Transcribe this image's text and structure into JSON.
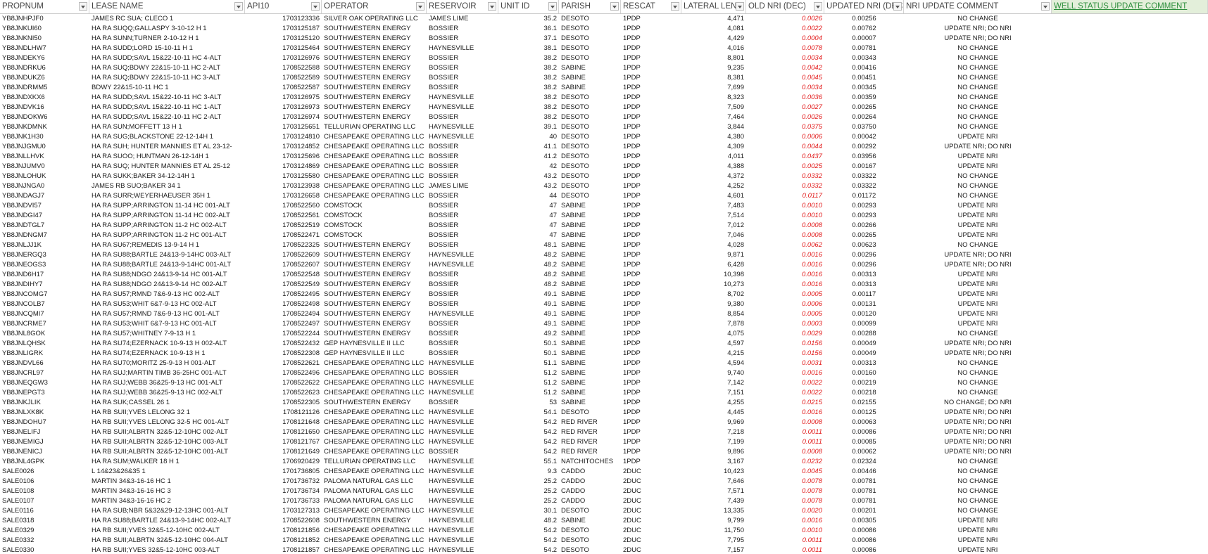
{
  "columns": [
    {
      "key": "propnum",
      "label": "PROPNUM"
    },
    {
      "key": "lease",
      "label": "LEASE NAME"
    },
    {
      "key": "api",
      "label": "API10"
    },
    {
      "key": "operator",
      "label": "OPERATOR"
    },
    {
      "key": "reservoir",
      "label": "RESERVOIR"
    },
    {
      "key": "unit_id",
      "label": "UNIT ID"
    },
    {
      "key": "parish",
      "label": "PARISH"
    },
    {
      "key": "rescat",
      "label": "RESCAT"
    },
    {
      "key": "lateral",
      "label": "LATERAL LEN"
    },
    {
      "key": "old_nri",
      "label": "OLD NRI (DEC)"
    },
    {
      "key": "new_nri",
      "label": "UPDATED NRI (DEC.)"
    },
    {
      "key": "comment",
      "label": "NRI UPDATE COMMENT"
    },
    {
      "key": "status",
      "label": "WELL STATUS UPDATE COMMENT"
    }
  ],
  "colors": {
    "old_nri_text": "#e21b1b",
    "highlight_header_bg": "#e3efda",
    "highlight_header_text": "#2f8f3e"
  },
  "rows": [
    [
      "YB8JNHPJF0",
      "JAMES RC SUA; CLECO 1",
      "1703123336",
      "SILVER OAK OPERATING LLC",
      "JAMES LIME",
      "35.2",
      "DESOTO",
      "1PDP",
      "4,471",
      "0.0026",
      "0.00256",
      "NO CHANGE",
      ""
    ],
    [
      "YB8JNKUI60",
      "HA RA SUQQ;GALLASPY 3-10-12 H 1",
      "1703125187",
      "SOUTHWESTERN ENERGY",
      "BOSSIER",
      "36.1",
      "DESOTO",
      "1PDP",
      "4,081",
      "0.0022",
      "0.00762",
      "UPDATE NRI; DO NRI",
      ""
    ],
    [
      "YB8JNKNI50",
      "HA RA SUNN;TURNER 2-10-12 H 1",
      "1703125120",
      "SOUTHWESTERN ENERGY",
      "BOSSIER",
      "37.1",
      "DESOTO",
      "1PDP",
      "4,429",
      "0.0004",
      "0.00007",
      "UPDATE NRI; DO NRI",
      ""
    ],
    [
      "YB8JNDLHW7",
      "HA RA SUDD;LORD 15-10-11 H 1",
      "1703125464",
      "SOUTHWESTERN ENERGY",
      "HAYNESVILLE",
      "38.1",
      "DESOTO",
      "1PDP",
      "4,016",
      "0.0078",
      "0.00781",
      "NO CHANGE",
      ""
    ],
    [
      "YB8JNDEKY6",
      "HA RA SUDD;SAVL 15&22-10-11 HC 4-ALT",
      "1703126976",
      "SOUTHWESTERN ENERGY",
      "BOSSIER",
      "38.2",
      "DESOTO",
      "1PDP",
      "8,801",
      "0.0034",
      "0.00343",
      "NO CHANGE",
      ""
    ],
    [
      "YB8JNDRKU6",
      "HA RA SUQ;BDWY 22&15-10-11 HC 2-ALT",
      "1708522588",
      "SOUTHWESTERN ENERGY",
      "BOSSIER",
      "38.2",
      "SABINE",
      "1PDP",
      "9,235",
      "0.0042",
      "0.00416",
      "NO CHANGE",
      ""
    ],
    [
      "YB8JNDUKZ6",
      "HA RA SUQ;BDWY 22&15-10-11 HC 3-ALT",
      "1708522589",
      "SOUTHWESTERN ENERGY",
      "BOSSIER",
      "38.2",
      "SABINE",
      "1PDP",
      "8,381",
      "0.0045",
      "0.00451",
      "NO CHANGE",
      ""
    ],
    [
      "YB8JNDRMM5",
      "BDWY 22&15-10-11 HC 1",
      "1708522587",
      "SOUTHWESTERN ENERGY",
      "BOSSIER",
      "38.2",
      "SABINE",
      "1PDP",
      "7,699",
      "0.0034",
      "0.00345",
      "NO CHANGE",
      ""
    ],
    [
      "YB8JNDXKX6",
      "HA RA SUDD;SAVL 15&22-10-11 HC 3-ALT",
      "1703126975",
      "SOUTHWESTERN ENERGY",
      "HAYNESVILLE",
      "38.2",
      "DESOTO",
      "1PDP",
      "8,323",
      "0.0036",
      "0.00359",
      "NO CHANGE",
      ""
    ],
    [
      "YB8JNDVK16",
      "HA RA SUDD;SAVL 15&22-10-11 HC 1-ALT",
      "1703126973",
      "SOUTHWESTERN ENERGY",
      "HAYNESVILLE",
      "38.2",
      "DESOTO",
      "1PDP",
      "7,509",
      "0.0027",
      "0.00265",
      "NO CHANGE",
      ""
    ],
    [
      "YB8JNDOKW6",
      "HA RA SUDD;SAVL 15&22-10-11 HC 2-ALT",
      "1703126974",
      "SOUTHWESTERN ENERGY",
      "BOSSIER",
      "38.2",
      "DESOTO",
      "1PDP",
      "7,464",
      "0.0026",
      "0.00264",
      "NO CHANGE",
      ""
    ],
    [
      "YB8JNKDMNK",
      "HA RA SUN;MOFFETT 13 H 1",
      "1703125651",
      "TELLURIAN OPERATING LLC",
      "HAYNESVILLE",
      "39.1",
      "DESOTO",
      "1PDP",
      "3,844",
      "0.0375",
      "0.03750",
      "NO CHANGE",
      ""
    ],
    [
      "YB8JNK1H30",
      "HA RA SUG;BLACKSTONE 22-12-14H 1",
      "1703124810",
      "CHESAPEAKE OPERATING LLC",
      "HAYNESVILLE",
      "40",
      "DESOTO",
      "1PDP",
      "4,380",
      "0.0006",
      "0.00042",
      "UPDATE NRI",
      ""
    ],
    [
      "YB8JNJGMU0",
      "HA RA SUH; HUNTER MANNIES ET AL 23-12-",
      "1703124852",
      "CHESAPEAKE OPERATING LLC",
      "BOSSIER",
      "41.1",
      "DESOTO",
      "1PDP",
      "4,309",
      "0.0044",
      "0.00292",
      "UPDATE NRI; DO NRI",
      ""
    ],
    [
      "YB8JNLLHVK",
      "HA RA SUOO; HUNTMAN 26-12-14H 1",
      "1703125696",
      "CHESAPEAKE OPERATING LLC",
      "BOSSIER",
      "41.2",
      "DESOTO",
      "1PDP",
      "4,011",
      "0.0437",
      "0.03956",
      "UPDATE NRI",
      ""
    ],
    [
      "YB8JNJUMV0",
      "HA RA SUQ; HUNTER MANNIES ET AL 25-12",
      "1703124869",
      "CHESAPEAKE OPERATING LLC",
      "BOSSIER",
      "42",
      "DESOTO",
      "1PDP",
      "4,388",
      "0.0025",
      "0.00167",
      "UPDATE NRI",
      ""
    ],
    [
      "YB8JNLOHUK",
      "HA RA SUKK;BAKER 34-12-14H 1",
      "1703125580",
      "CHESAPEAKE OPERATING LLC",
      "BOSSIER",
      "43.2",
      "DESOTO",
      "1PDP",
      "4,372",
      "0.0332",
      "0.03322",
      "NO CHANGE",
      ""
    ],
    [
      "YB8JNJNGA0",
      "JAMES RB SUO;BAKER 34 1",
      "1703123938",
      "CHESAPEAKE OPERATING LLC",
      "JAMES LIME",
      "43.2",
      "DESOTO",
      "1PDP",
      "4,252",
      "0.0332",
      "0.03322",
      "NO CHANGE",
      ""
    ],
    [
      "YB8JNDAGJ7",
      "HA RA SURR;WEYERHAEUSER 35H 1",
      "1703126658",
      "CHESAPEAKE OPERATING LLC",
      "BOSSIER",
      "44",
      "DESOTO",
      "1PDP",
      "4,601",
      "0.0117",
      "0.01172",
      "NO CHANGE",
      ""
    ],
    [
      "YB8JNDVI57",
      "HA RA SUPP;ARRINGTON 11-14 HC 001-ALT",
      "1708522560",
      "COMSTOCK",
      "BOSSIER",
      "47",
      "SABINE",
      "1PDP",
      "7,483",
      "0.0010",
      "0.00293",
      "UPDATE NRI",
      ""
    ],
    [
      "YB8JNDGI47",
      "HA RA SUPP;ARRINGTON 11-14 HC 002-ALT",
      "1708522561",
      "COMSTOCK",
      "BOSSIER",
      "47",
      "SABINE",
      "1PDP",
      "7,514",
      "0.0010",
      "0.00293",
      "UPDATE NRI",
      ""
    ],
    [
      "YB8JNDTGL7",
      "HA RA SUPP;ARRINGTON 11-2 HC 002-ALT",
      "1708522519",
      "COMSTOCK",
      "BOSSIER",
      "47",
      "SABINE",
      "1PDP",
      "7,012",
      "0.0008",
      "0.00266",
      "UPDATE NRI",
      ""
    ],
    [
      "YB8JNDNGM7",
      "HA RA SUPP;ARRINGTON 11-2 HC 001-ALT",
      "1708522471",
      "COMSTOCK",
      "BOSSIER",
      "47",
      "SABINE",
      "1PDP",
      "7,046",
      "0.0008",
      "0.00265",
      "UPDATE NRI",
      ""
    ],
    [
      "YB8JNLJJ1K",
      "HA RA SU67;REMEDIS 13-9-14 H 1",
      "1708522325",
      "SOUTHWESTERN ENERGY",
      "BOSSIER",
      "48.1",
      "SABINE",
      "1PDP",
      "4,028",
      "0.0062",
      "0.00623",
      "NO CHANGE",
      ""
    ],
    [
      "YB8JNERGQ3",
      "HA RA SU88;BARTLE 24&13-9-14HC 003-ALT",
      "1708522609",
      "SOUTHWESTERN ENERGY",
      "HAYNESVILLE",
      "48.2",
      "SABINE",
      "1PDP",
      "9,871",
      "0.0016",
      "0.00296",
      "UPDATE NRI; DO NRI",
      ""
    ],
    [
      "YB8JNEOGS3",
      "HA RA SU88;BARTLE 24&13-9-14HC 001-ALT",
      "1708522607",
      "SOUTHWESTERN ENERGY",
      "HAYNESVILLE",
      "48.2",
      "SABINE",
      "1PDP",
      "6,428",
      "0.0016",
      "0.00296",
      "UPDATE NRI; DO NRI",
      ""
    ],
    [
      "YB8JND6H17",
      "HA RA SU88;NDGO 24&13-9-14 HC 001-ALT",
      "1708522548",
      "SOUTHWESTERN ENERGY",
      "BOSSIER",
      "48.2",
      "SABINE",
      "1PDP",
      "10,398",
      "0.0016",
      "0.00313",
      "UPDATE NRI",
      ""
    ],
    [
      "YB8JNDIHY7",
      "HA RA SU88;NDGO 24&13-9-14 HC 002-ALT",
      "1708522549",
      "SOUTHWESTERN ENERGY",
      "BOSSIER",
      "48.2",
      "SABINE",
      "1PDP",
      "10,273",
      "0.0016",
      "0.00313",
      "UPDATE NRI",
      ""
    ],
    [
      "YB8JNCOMG7",
      "HA RA SU57;RMND 7&6-9-13 HC 002-ALT",
      "1708522495",
      "SOUTHWESTERN ENERGY",
      "BOSSIER",
      "49.1",
      "SABINE",
      "1PDP",
      "8,702",
      "0.0005",
      "0.00117",
      "UPDATE NRI",
      ""
    ],
    [
      "YB8JNCOLB7",
      "HA RA SU53;WHIT 6&7-9-13 HC 002-ALT",
      "1708522498",
      "SOUTHWESTERN ENERGY",
      "BOSSIER",
      "49.1",
      "SABINE",
      "1PDP",
      "9,380",
      "0.0006",
      "0.00131",
      "UPDATE NRI",
      ""
    ],
    [
      "YB8JNCQMI7",
      "HA RA SU57;RMND 7&6-9-13 HC 001-ALT",
      "1708522494",
      "SOUTHWESTERN ENERGY",
      "HAYNESVILLE",
      "49.1",
      "SABINE",
      "1PDP",
      "8,854",
      "0.0005",
      "0.00120",
      "UPDATE NRI",
      ""
    ],
    [
      "YB8JNCRME7",
      "HA RA SU53;WHIT 6&7-9-13 HC 001-ALT",
      "1708522497",
      "SOUTHWESTERN ENERGY",
      "BOSSIER",
      "49.1",
      "SABINE",
      "1PDP",
      "7,878",
      "0.0003",
      "0.00099",
      "UPDATE NRI",
      ""
    ],
    [
      "YB8JNL8GOK",
      "HA RA SU57;WHITNEY 7-9-13 H 1",
      "1708522244",
      "SOUTHWESTERN ENERGY",
      "BOSSIER",
      "49.2",
      "SABINE",
      "1PDP",
      "4,075",
      "0.0029",
      "0.00288",
      "NO CHANGE",
      ""
    ],
    [
      "YB8JNLQHSK",
      "HA RA SU74;EZERNACK 10-9-13 H 002-ALT",
      "1708522432",
      "GEP HAYNESVILLE II LLC",
      "BOSSIER",
      "50.1",
      "SABINE",
      "1PDP",
      "4,597",
      "0.0156",
      "0.00049",
      "UPDATE NRI; DO NRI",
      ""
    ],
    [
      "YB8JNLIGRK",
      "HA RA SU74;EZERNACK 10-9-13 H 1",
      "1708522308",
      "GEP HAYNESVILLE II LLC",
      "BOSSIER",
      "50.1",
      "SABINE",
      "1PDP",
      "4,215",
      "0.0156",
      "0.00049",
      "UPDATE NRI; DO NRI",
      ""
    ],
    [
      "YB8JNDVL66",
      "HA RA SU70;MORITZ 25-9-13 H 001-ALT",
      "1708522621",
      "CHESAPEAKE OPERATING LLC",
      "HAYNESVILLE",
      "51.1",
      "SABINE",
      "1PDP",
      "4,594",
      "0.0031",
      "0.00313",
      "NO CHANGE",
      ""
    ],
    [
      "YB8JNCRL97",
      "HA RA SUJ;MARTIN TIMB 36-25HC 001-ALT",
      "1708522496",
      "CHESAPEAKE OPERATING LLC",
      "BOSSIER",
      "51.2",
      "SABINE",
      "1PDP",
      "9,740",
      "0.0016",
      "0.00160",
      "NO CHANGE",
      ""
    ],
    [
      "YB8JNEQGW3",
      "HA RA SUJ;WEBB 36&25-9-13 HC 001-ALT",
      "1708522622",
      "CHESAPEAKE OPERATING LLC",
      "HAYNESVILLE",
      "51.2",
      "SABINE",
      "1PDP",
      "7,142",
      "0.0022",
      "0.00219",
      "NO CHANGE",
      ""
    ],
    [
      "YB8JNEPGT3",
      "HA RA SUJ;WEBB 36&25-9-13 HC 002-ALT",
      "1708522623",
      "CHESAPEAKE OPERATING LLC",
      "HAYNESVILLE",
      "51.2",
      "SABINE",
      "1PDP",
      "7,151",
      "0.0022",
      "0.00218",
      "NO CHANGE",
      ""
    ],
    [
      "YB8JNKJLIK",
      "HA RA SUK;CASSEL 26 1",
      "1708522305",
      "SOUTHWESTERN ENERGY",
      "BOSSIER",
      "53",
      "SABINE",
      "1PDP",
      "4,255",
      "0.0215",
      "0.02155",
      "NO CHANGE; DO NRI",
      ""
    ],
    [
      "YB8JNLXK8K",
      "HA RB SUII;YVES LELONG 32 1",
      "1708121126",
      "CHESAPEAKE OPERATING LLC",
      "HAYNESVILLE",
      "54.1",
      "DESOTO",
      "1PDP",
      "4,445",
      "0.0016",
      "0.00125",
      "UPDATE NRI; DO NRI",
      ""
    ],
    [
      "YB8JNDOHU7",
      "HA RB SUII;YVES LELONG 32-5 HC 001-ALT",
      "1708121648",
      "CHESAPEAKE OPERATING LLC",
      "HAYNESVILLE",
      "54.2",
      "RED RIVER",
      "1PDP",
      "9,969",
      "0.0008",
      "0.00063",
      "UPDATE NRI; DO NRI",
      ""
    ],
    [
      "YB8JNELIFJ",
      "HA RB SUII;ALBRTN 32&5-12-10HC 002-ALT",
      "1708121650",
      "CHESAPEAKE OPERATING LLC",
      "HAYNESVILLE",
      "54.2",
      "RED RIVER",
      "1PDP",
      "7,218",
      "0.0011",
      "0.00086",
      "UPDATE NRI; DO NRI",
      ""
    ],
    [
      "YB8JNEMIGJ",
      "HA RB SUII;ALBRTN 32&5-12-10HC 003-ALT",
      "1708121767",
      "CHESAPEAKE OPERATING LLC",
      "HAYNESVILLE",
      "54.2",
      "RED RIVER",
      "1PDP",
      "7,199",
      "0.0011",
      "0.00085",
      "UPDATE NRI; DO NRI",
      ""
    ],
    [
      "YB8JNENICJ",
      "HA RB SUII;ALBRTN 32&5-12-10HC 001-ALT",
      "1708121649",
      "CHESAPEAKE OPERATING LLC",
      "BOSSIER",
      "54.2",
      "RED RIVER",
      "1PDP",
      "9,896",
      "0.0008",
      "0.00062",
      "UPDATE NRI; DO NRI",
      ""
    ],
    [
      "YB8JNL4GPK",
      "HA RA SUM;WALKER 18 H 1",
      "1706920429",
      "TELLURIAN OPERATING LLC",
      "HAYNESVILLE",
      "55.1",
      "NATCHITOCHES",
      "1PDP",
      "3,167",
      "0.0232",
      "0.02324",
      "NO CHANGE",
      ""
    ],
    [
      "SALE0026",
      "L 14&23&26&35 1",
      "1701736805",
      "CHESAPEAKE OPERATING LLC",
      "HAYNESVILLE",
      "9.3",
      "CADDO",
      "2DUC",
      "10,423",
      "0.0045",
      "0.00446",
      "NO CHANGE",
      ""
    ],
    [
      "SALE0106",
      "MARTIN 34&3-16-16 HC 1",
      "1701736732",
      "PALOMA NATURAL GAS LLC",
      "HAYNESVILLE",
      "25.2",
      "CADDO",
      "2DUC",
      "7,646",
      "0.0078",
      "0.00781",
      "NO CHANGE",
      ""
    ],
    [
      "SALE0108",
      "MARTIN 34&3-16-16 HC 3",
      "1701736734",
      "PALOMA NATURAL GAS LLC",
      "HAYNESVILLE",
      "25.2",
      "CADDO",
      "2DUC",
      "7,571",
      "0.0078",
      "0.00781",
      "NO CHANGE",
      ""
    ],
    [
      "SALE0107",
      "MARTIN 34&3-16-16 HC 2",
      "1701736733",
      "PALOMA NATURAL GAS LLC",
      "HAYNESVILLE",
      "25.2",
      "CADDO",
      "2DUC",
      "7,439",
      "0.0078",
      "0.00781",
      "NO CHANGE",
      ""
    ],
    [
      "SALE0116",
      "HA RA SUB;NBR 5&32&29-12-13HC 001-ALT",
      "1703127313",
      "CHESAPEAKE OPERATING LLC",
      "HAYNESVILLE",
      "30.1",
      "DESOTO",
      "2DUC",
      "13,335",
      "0.0020",
      "0.00201",
      "NO CHANGE",
      ""
    ],
    [
      "SALE0318",
      "HA RA SU88;BARTLE 24&13-9-14HC 002-ALT",
      "1708522608",
      "SOUTHWESTERN ENERGY",
      "HAYNESVILLE",
      "48.2",
      "SABINE",
      "2DUC",
      "9,799",
      "0.0016",
      "0.00305",
      "UPDATE NRI",
      ""
    ],
    [
      "SALE0329",
      "HA RB SUII;YVES 32&5-12-10HC 002-ALT",
      "1708121856",
      "CHESAPEAKE OPERATING LLC",
      "HAYNESVILLE",
      "54.2",
      "DESOTO",
      "2DUC",
      "11,750",
      "0.0010",
      "0.00086",
      "UPDATE NRI",
      ""
    ],
    [
      "SALE0332",
      "HA RB SUII;ALBRTN 32&5-12-10HC 004-ALT",
      "1708121852",
      "CHESAPEAKE OPERATING LLC",
      "HAYNESVILLE",
      "54.2",
      "DESOTO",
      "2DUC",
      "7,795",
      "0.0011",
      "0.00086",
      "UPDATE NRI",
      ""
    ],
    [
      "SALE0330",
      "HA RB SUII;YVES 32&5-12-10HC 003-ALT",
      "1708121857",
      "CHESAPEAKE OPERATING LLC",
      "HAYNESVILLE",
      "54.2",
      "DESOTO",
      "2DUC",
      "7,157",
      "0.0011",
      "0.00086",
      "UPDATE NRI",
      ""
    ]
  ]
}
